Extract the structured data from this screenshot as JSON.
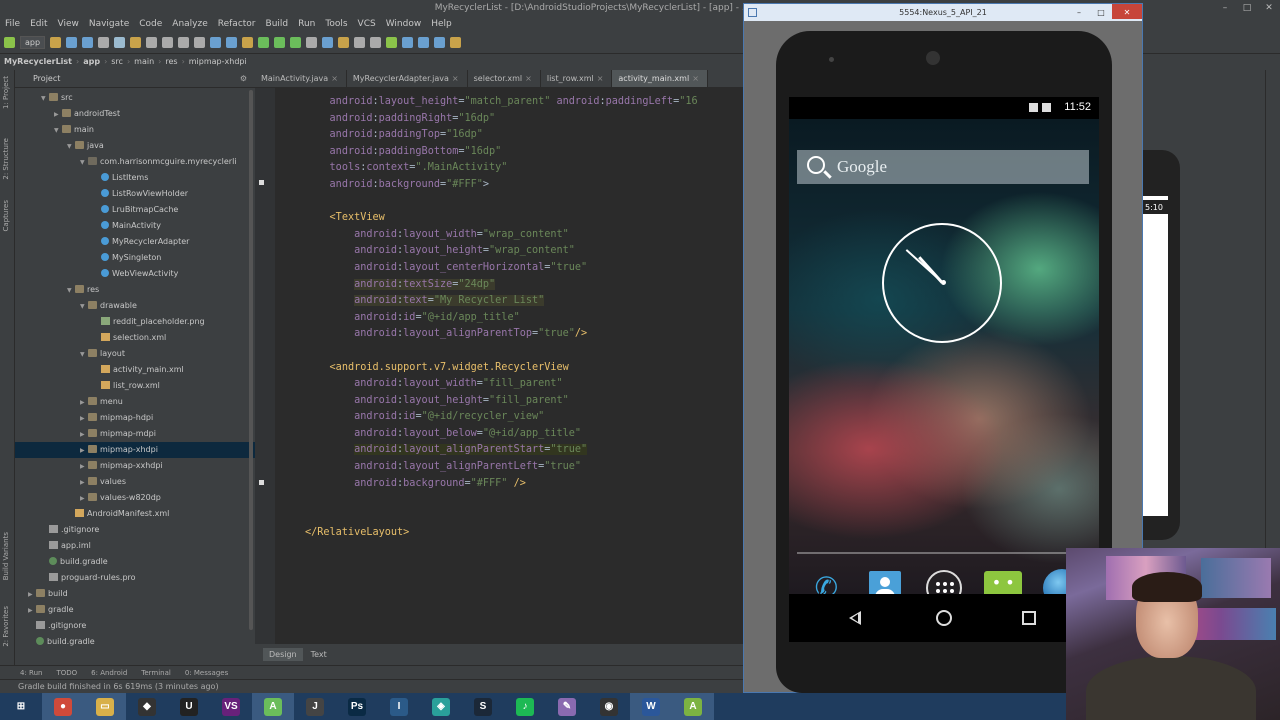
{
  "window": {
    "title": "MyRecyclerList - [D:\\AndroidStudioProjects\\MyRecyclerList] - [app] - ...\\app\\src\\main\\res\\lay",
    "buttons": [
      "–",
      "□",
      "✕"
    ]
  },
  "menu": [
    "File",
    "Edit",
    "View",
    "Navigate",
    "Code",
    "Analyze",
    "Refactor",
    "Build",
    "Run",
    "Tools",
    "VCS",
    "Window",
    "Help"
  ],
  "toolbar": {
    "run_config": "app",
    "colors": [
      "#c8a24a",
      "#6aa0d0",
      "#6aa0d0",
      "#aaaaaa",
      "#9bbbd0",
      "#c8a24a",
      "#aaaaaa",
      "#aaaaaa",
      "#aaaaaa",
      "#aaaaaa",
      "#6aa0d0",
      "#6aa0d0",
      "#8bc34a",
      "#c8a24a",
      "#6bbd5b",
      "#6bbd5b",
      "#6bbd5b",
      "#aaaaaa",
      "#6aa0d0",
      "#c8a24a",
      "#aaaaaa",
      "#aaaaaa",
      "#8bc34a",
      "#6aa0d0",
      "#6aa0d0",
      "#6aa0d0",
      "#c8a24a"
    ]
  },
  "breadcrumb": [
    "MyRecyclerList",
    "app",
    "src",
    "main",
    "res",
    "mipmap-xhdpi"
  ],
  "left_strip": {
    "project": "1: Project",
    "structure": "2: Structure",
    "captures": "Captures",
    "build_variants": "Build Variants",
    "favorites": "2: Favorites"
  },
  "project_panel": {
    "title": "Project",
    "tree": [
      {
        "label": "src",
        "depth": 2,
        "arrow": "down",
        "icon": "folder"
      },
      {
        "label": "androidTest",
        "depth": 3,
        "arrow": "right",
        "icon": "folder"
      },
      {
        "label": "main",
        "depth": 3,
        "arrow": "down",
        "icon": "folder"
      },
      {
        "label": "java",
        "depth": 4,
        "arrow": "down",
        "icon": "folder"
      },
      {
        "label": "com.harrisonmcguire.myrecyclerli",
        "depth": 5,
        "arrow": "down",
        "icon": "pkg"
      },
      {
        "label": "ListItems",
        "depth": 6,
        "arrow": "",
        "icon": "cls"
      },
      {
        "label": "ListRowViewHolder",
        "depth": 6,
        "arrow": "",
        "icon": "cls"
      },
      {
        "label": "LruBitmapCache",
        "depth": 6,
        "arrow": "",
        "icon": "cls"
      },
      {
        "label": "MainActivity",
        "depth": 6,
        "arrow": "",
        "icon": "cls"
      },
      {
        "label": "MyRecyclerAdapter",
        "depth": 6,
        "arrow": "",
        "icon": "cls"
      },
      {
        "label": "MySingleton",
        "depth": 6,
        "arrow": "",
        "icon": "cls"
      },
      {
        "label": "WebViewActivity",
        "depth": 6,
        "arrow": "",
        "icon": "cls"
      },
      {
        "label": "res",
        "depth": 4,
        "arrow": "down",
        "icon": "folder"
      },
      {
        "label": "drawable",
        "depth": 5,
        "arrow": "down",
        "icon": "folder"
      },
      {
        "label": "reddit_placeholder.png",
        "depth": 6,
        "arrow": "",
        "icon": "img"
      },
      {
        "label": "selection.xml",
        "depth": 6,
        "arrow": "",
        "icon": "xml"
      },
      {
        "label": "layout",
        "depth": 5,
        "arrow": "down",
        "icon": "folder"
      },
      {
        "label": "activity_main.xml",
        "depth": 6,
        "arrow": "",
        "icon": "xml"
      },
      {
        "label": "list_row.xml",
        "depth": 6,
        "arrow": "",
        "icon": "xml"
      },
      {
        "label": "menu",
        "depth": 5,
        "arrow": "right",
        "icon": "folder"
      },
      {
        "label": "mipmap-hdpi",
        "depth": 5,
        "arrow": "right",
        "icon": "folder"
      },
      {
        "label": "mipmap-mdpi",
        "depth": 5,
        "arrow": "right",
        "icon": "folder"
      },
      {
        "label": "mipmap-xhdpi",
        "depth": 5,
        "arrow": "right",
        "icon": "folder",
        "selected": true
      },
      {
        "label": "mipmap-xxhdpi",
        "depth": 5,
        "arrow": "right",
        "icon": "folder"
      },
      {
        "label": "values",
        "depth": 5,
        "arrow": "right",
        "icon": "folder"
      },
      {
        "label": "values-w820dp",
        "depth": 5,
        "arrow": "right",
        "icon": "folder"
      },
      {
        "label": "AndroidManifest.xml",
        "depth": 4,
        "arrow": "",
        "icon": "xml"
      },
      {
        "label": ".gitignore",
        "depth": 2,
        "arrow": "",
        "icon": "txt"
      },
      {
        "label": "app.iml",
        "depth": 2,
        "arrow": "",
        "icon": "txt"
      },
      {
        "label": "build.gradle",
        "depth": 2,
        "arrow": "",
        "icon": "gr"
      },
      {
        "label": "proguard-rules.pro",
        "depth": 2,
        "arrow": "",
        "icon": "txt"
      },
      {
        "label": "build",
        "depth": 1,
        "arrow": "right",
        "icon": "folder"
      },
      {
        "label": "gradle",
        "depth": 1,
        "arrow": "right",
        "icon": "folder"
      },
      {
        "label": ".gitignore",
        "depth": 1,
        "arrow": "",
        "icon": "txt"
      },
      {
        "label": "build.gradle",
        "depth": 1,
        "arrow": "",
        "icon": "gr"
      }
    ]
  },
  "editor": {
    "tabs": [
      {
        "label": "MainActivity.java",
        "active": false
      },
      {
        "label": "MyRecyclerAdapter.java",
        "active": false
      },
      {
        "label": "selector.xml",
        "active": false
      },
      {
        "label": "list_row.xml",
        "active": false
      },
      {
        "label": "activity_main.xml",
        "active": true
      }
    ],
    "bottom_tabs": [
      "Design",
      "Text"
    ],
    "lines": [
      {
        "indent": 4,
        "parts": [
          [
            "ns",
            "android"
          ],
          [
            "p",
            ":"
          ],
          [
            "attr",
            "layout_height"
          ],
          [
            "p",
            "="
          ],
          [
            "val",
            "\"match_parent\""
          ],
          [
            "p",
            " "
          ],
          [
            "ns",
            "android"
          ],
          [
            "p",
            ":"
          ],
          [
            "attr",
            "paddingLeft"
          ],
          [
            "p",
            "="
          ],
          [
            "val",
            "\"16"
          ]
        ]
      },
      {
        "indent": 4,
        "parts": [
          [
            "ns",
            "android"
          ],
          [
            "p",
            ":"
          ],
          [
            "attr",
            "paddingRight"
          ],
          [
            "p",
            "="
          ],
          [
            "val",
            "\"16dp\""
          ]
        ]
      },
      {
        "indent": 4,
        "parts": [
          [
            "ns",
            "android"
          ],
          [
            "p",
            ":"
          ],
          [
            "attr",
            "paddingTop"
          ],
          [
            "p",
            "="
          ],
          [
            "val",
            "\"16dp\""
          ]
        ]
      },
      {
        "indent": 4,
        "parts": [
          [
            "ns",
            "android"
          ],
          [
            "p",
            ":"
          ],
          [
            "attr",
            "paddingBottom"
          ],
          [
            "p",
            "="
          ],
          [
            "val",
            "\"16dp\""
          ]
        ]
      },
      {
        "indent": 4,
        "parts": [
          [
            "ns",
            "tools"
          ],
          [
            "p",
            ":"
          ],
          [
            "attr",
            "context"
          ],
          [
            "p",
            "="
          ],
          [
            "val",
            "\".MainActivity\""
          ]
        ]
      },
      {
        "indent": 4,
        "parts": [
          [
            "ns",
            "android"
          ],
          [
            "p",
            ":"
          ],
          [
            "attr",
            "background"
          ],
          [
            "p",
            "="
          ],
          [
            "val",
            "\"#FFF\""
          ],
          [
            "p",
            ">"
          ]
        ]
      },
      {
        "indent": 0,
        "parts": []
      },
      {
        "indent": 4,
        "parts": [
          [
            "tag",
            "<TextView"
          ]
        ]
      },
      {
        "indent": 8,
        "parts": [
          [
            "ns",
            "android"
          ],
          [
            "p",
            ":"
          ],
          [
            "attr",
            "layout_width"
          ],
          [
            "p",
            "="
          ],
          [
            "val",
            "\"wrap_content\""
          ]
        ]
      },
      {
        "indent": 8,
        "parts": [
          [
            "ns",
            "android"
          ],
          [
            "p",
            ":"
          ],
          [
            "attr",
            "layout_height"
          ],
          [
            "p",
            "="
          ],
          [
            "val",
            "\"wrap_content\""
          ]
        ]
      },
      {
        "indent": 8,
        "parts": [
          [
            "ns",
            "android"
          ],
          [
            "p",
            ":"
          ],
          [
            "attr",
            "layout_centerHorizontal"
          ],
          [
            "p",
            "="
          ],
          [
            "val",
            "\"true\""
          ]
        ]
      },
      {
        "indent": 8,
        "hl": true,
        "parts": [
          [
            "ns",
            "android"
          ],
          [
            "p",
            ":"
          ],
          [
            "attr",
            "textSize"
          ],
          [
            "p",
            "="
          ],
          [
            "val",
            "\"24dp\""
          ]
        ]
      },
      {
        "indent": 8,
        "hl": true,
        "parts": [
          [
            "ns",
            "android"
          ],
          [
            "p",
            ":"
          ],
          [
            "attr",
            "text"
          ],
          [
            "p",
            "="
          ],
          [
            "val",
            "\"My Recycler List\""
          ]
        ]
      },
      {
        "indent": 8,
        "parts": [
          [
            "ns",
            "android"
          ],
          [
            "p",
            ":"
          ],
          [
            "attr",
            "id"
          ],
          [
            "p",
            "="
          ],
          [
            "val",
            "\"@+id/app_title\""
          ]
        ]
      },
      {
        "indent": 8,
        "parts": [
          [
            "ns",
            "android"
          ],
          [
            "p",
            ":"
          ],
          [
            "attr",
            "layout_alignParentTop"
          ],
          [
            "p",
            "="
          ],
          [
            "val",
            "\"true\""
          ],
          [
            "tag",
            "/>"
          ]
        ]
      },
      {
        "indent": 0,
        "parts": []
      },
      {
        "indent": 4,
        "parts": [
          [
            "tag",
            "<android.support.v7.widget.RecyclerView"
          ]
        ]
      },
      {
        "indent": 8,
        "parts": [
          [
            "ns",
            "android"
          ],
          [
            "p",
            ":"
          ],
          [
            "attr",
            "layout_width"
          ],
          [
            "p",
            "="
          ],
          [
            "val",
            "\"fill_parent\""
          ]
        ]
      },
      {
        "indent": 8,
        "parts": [
          [
            "ns",
            "android"
          ],
          [
            "p",
            ":"
          ],
          [
            "attr",
            "layout_height"
          ],
          [
            "p",
            "="
          ],
          [
            "val",
            "\"fill_parent\""
          ]
        ]
      },
      {
        "indent": 8,
        "parts": [
          [
            "ns",
            "android"
          ],
          [
            "p",
            ":"
          ],
          [
            "attr",
            "id"
          ],
          [
            "p",
            "="
          ],
          [
            "val",
            "\"@+id/recycler_view\""
          ]
        ]
      },
      {
        "indent": 8,
        "parts": [
          [
            "ns",
            "android"
          ],
          [
            "p",
            ":"
          ],
          [
            "attr",
            "layout_below"
          ],
          [
            "p",
            "="
          ],
          [
            "val",
            "\"@+id/app_title\""
          ]
        ]
      },
      {
        "indent": 8,
        "cur": true,
        "parts": [
          [
            "ns",
            "android"
          ],
          [
            "p",
            ":"
          ],
          [
            "attr",
            "layout_alignParentStart"
          ],
          [
            "p",
            "="
          ],
          [
            "val",
            "\"true\""
          ]
        ]
      },
      {
        "indent": 8,
        "parts": [
          [
            "ns",
            "android"
          ],
          [
            "p",
            ":"
          ],
          [
            "attr",
            "layout_alignParentLeft"
          ],
          [
            "p",
            "="
          ],
          [
            "val",
            "\"true\""
          ]
        ]
      },
      {
        "indent": 8,
        "parts": [
          [
            "ns",
            "android"
          ],
          [
            "p",
            ":"
          ],
          [
            "attr",
            "background"
          ],
          [
            "p",
            "="
          ],
          [
            "val",
            "\"#FFF\""
          ],
          [
            "p",
            " "
          ],
          [
            "tag",
            "/>"
          ]
        ]
      },
      {
        "indent": 0,
        "parts": []
      },
      {
        "indent": 0,
        "parts": []
      },
      {
        "indent": 0,
        "parts": [
          [
            "tag",
            "</RelativeLayout>"
          ]
        ]
      }
    ]
  },
  "tool_windows": [
    "4: Run",
    "TODO",
    "6: Android",
    "Terminal",
    "0: Messages"
  ],
  "status": "Gradle build finished in 6s 619ms (3 minutes ago)",
  "emulator": {
    "title": "5554:Nexus_5_API_21",
    "time": "11:52",
    "search_label": "Google",
    "buttons": [
      "–",
      "□",
      "✕"
    ]
  },
  "preview": {
    "time": "5:10"
  },
  "taskbar": [
    {
      "name": "start-button",
      "glyph": "⊞",
      "color": "#1f3c5e"
    },
    {
      "name": "chrome-app",
      "glyph": "●",
      "color": "#d04a3a",
      "active": true
    },
    {
      "name": "explorer-app",
      "glyph": "▭",
      "color": "#d8b04a",
      "active": true
    },
    {
      "name": "unity-app",
      "glyph": "◆",
      "color": "#333333"
    },
    {
      "name": "unreal-app",
      "glyph": "U",
      "color": "#222222"
    },
    {
      "name": "visualstudio-app",
      "glyph": "VS",
      "color": "#68217a"
    },
    {
      "name": "androidstudio-app",
      "glyph": "A",
      "color": "#6bbd5b",
      "active": true
    },
    {
      "name": "jetbrains-app",
      "glyph": "J",
      "color": "#444444"
    },
    {
      "name": "photoshop-app",
      "glyph": "Ps",
      "color": "#0a2a44"
    },
    {
      "name": "intellij-app",
      "glyph": "I",
      "color": "#2b5a88"
    },
    {
      "name": "android-sdk-app",
      "glyph": "◈",
      "color": "#2aa09a"
    },
    {
      "name": "steam-app",
      "glyph": "S",
      "color": "#1b2838"
    },
    {
      "name": "spotify-app",
      "glyph": "♪",
      "color": "#1db954"
    },
    {
      "name": "paint-app",
      "glyph": "✎",
      "color": "#8a6ab0"
    },
    {
      "name": "obs-app",
      "glyph": "◉",
      "color": "#333333"
    },
    {
      "name": "word-app",
      "glyph": "W",
      "color": "#2b579a",
      "active": true
    },
    {
      "name": "android-emulator-app",
      "glyph": "A",
      "color": "#7cb342",
      "active": true
    }
  ]
}
